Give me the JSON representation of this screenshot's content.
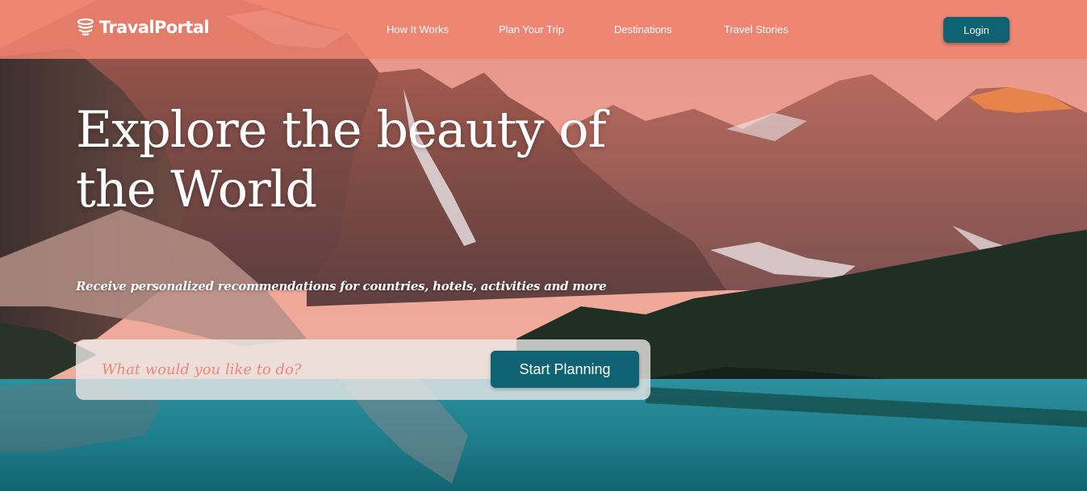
{
  "brand": {
    "name": "TravalPortal",
    "icon": "globe-stack-icon"
  },
  "nav": {
    "links": [
      "How It Works",
      "Plan Your Trip",
      "Destinations",
      "Travel Stories"
    ],
    "login_label": "Login"
  },
  "hero": {
    "title": "Explore the beauty of the World",
    "subtitle": "Receive personalized recommendations for countries, hotels, activities and more"
  },
  "search": {
    "placeholder": "What would you like to do?",
    "button_label": "Start Planning"
  },
  "colors": {
    "nav_bar": "#f08270",
    "button": "#0e6272",
    "placeholder": "#ee8878"
  }
}
